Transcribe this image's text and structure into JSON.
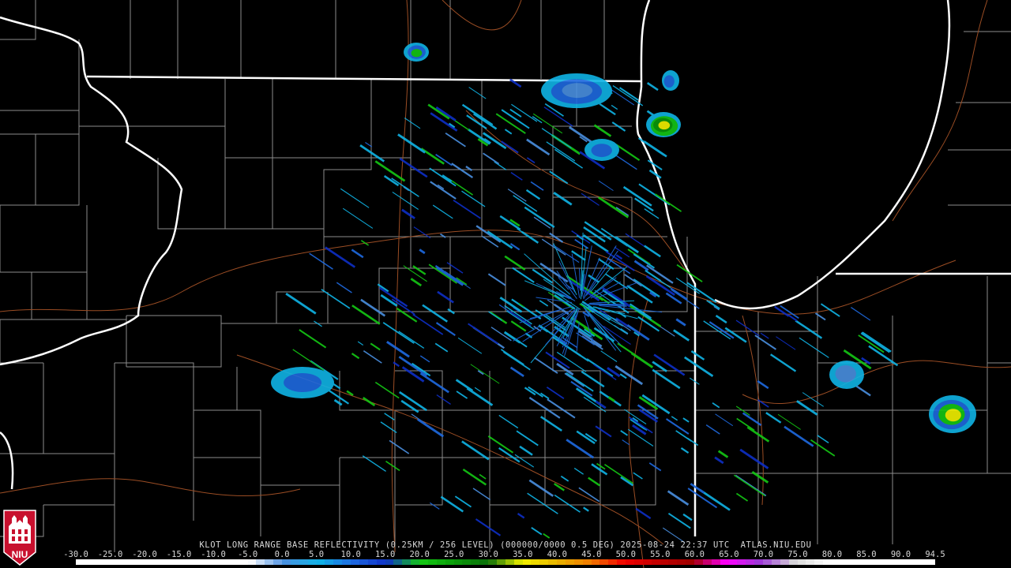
{
  "product": {
    "caption": "KLOT LONG RANGE BASE REFLECTIVITY (0.25KM / 256 LEVEL) (000000/0000 0.5 DEG) 2025-08-24 22:37 UTC  ATLAS.NIU.EDU",
    "logo_text": "NIU"
  },
  "scale": {
    "labels": [
      "-30.0",
      "-25.0",
      "-20.0",
      "-15.0",
      "-10.0",
      "-5.0",
      "0.0",
      "5.0",
      "10.0",
      "15.0",
      "20.0",
      "25.0",
      "30.0",
      "35.0",
      "40.0",
      "45.0",
      "50.0",
      "55.0",
      "60.0",
      "65.0",
      "70.0",
      "75.0",
      "80.0",
      "85.0",
      "90.0",
      "94.5"
    ],
    "colors": [
      "#ffffff",
      "#ffffff",
      "#ffffff",
      "#ffffff",
      "#ffffff",
      "#ffffff",
      "#4a8fe0",
      "#10b4e6",
      "#1e6ae0",
      "#0e2fc6",
      "#14c814",
      "#0a9a0a",
      "#0a6e0a",
      "#f2f200",
      "#e8b400",
      "#f07a00",
      "#f00000",
      "#c00000",
      "#a00000",
      "#ff00ff",
      "#9a3ad6",
      "#d8d8d8",
      "#ffffff",
      "#ffffff",
      "#ffffff",
      "#ffffff"
    ]
  },
  "colors": {
    "background": "#000000",
    "state_border": "#ffffff",
    "county_border": "#8c8c8c",
    "highway": "#9b4d24",
    "logo_red": "#c8102e"
  }
}
